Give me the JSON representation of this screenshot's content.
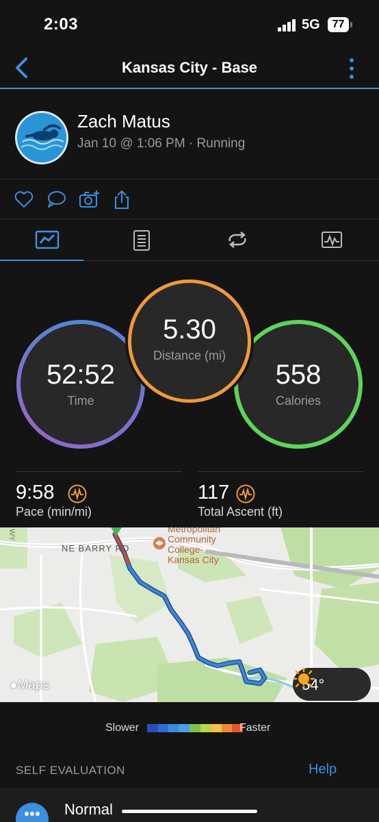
{
  "status_bar": {
    "time": "2:03",
    "network": "5G",
    "battery": "77"
  },
  "nav": {
    "title": "Kansas City - Base"
  },
  "profile": {
    "name": "Zach Matus",
    "meta": "Jan 10 @ 1:06 PM · Running"
  },
  "actions": [
    "heart-icon",
    "comment-icon",
    "add-photo-icon",
    "share-icon"
  ],
  "tabs": [
    {
      "name": "summary",
      "icon": "stats-icon",
      "active": true
    },
    {
      "name": "details",
      "icon": "document-icon",
      "active": false
    },
    {
      "name": "laps",
      "icon": "laps-icon",
      "active": false
    },
    {
      "name": "charts",
      "icon": "chart-icon",
      "active": false
    }
  ],
  "metrics": {
    "time": {
      "value": "52:52",
      "label": "Time",
      "color": "#8a6fd1"
    },
    "distance": {
      "value": "5.30",
      "label": "Distance (mi)",
      "color": "#f0993a"
    },
    "calories": {
      "value": "558",
      "label": "Calories",
      "color": "#5fd35a"
    }
  },
  "stats": {
    "pace": {
      "value": "9:58",
      "label": "Pace (min/mi)"
    },
    "ascent": {
      "value": "117",
      "label": "Total Ascent (ft)"
    }
  },
  "map": {
    "labels": {
      "street": "NE BARRY RD",
      "edge": "WY",
      "college_1": "Metropolitan",
      "college_2": "Community",
      "college_3": "College-",
      "college_4": "Kansas City"
    },
    "attribution": "Maps",
    "weather_temp": "54°"
  },
  "legend": {
    "slower": "Slower",
    "faster": "Faster",
    "colors": [
      "#2b4fb8",
      "#2f6bd6",
      "#3e8ae0",
      "#4aa0e8",
      "#7ec24a",
      "#b8d64a",
      "#f2c14a",
      "#f08a3a",
      "#e8532e"
    ]
  },
  "self_evaluation": {
    "title": "SELF EVALUATION",
    "help": "Help",
    "feel": "Normal"
  }
}
